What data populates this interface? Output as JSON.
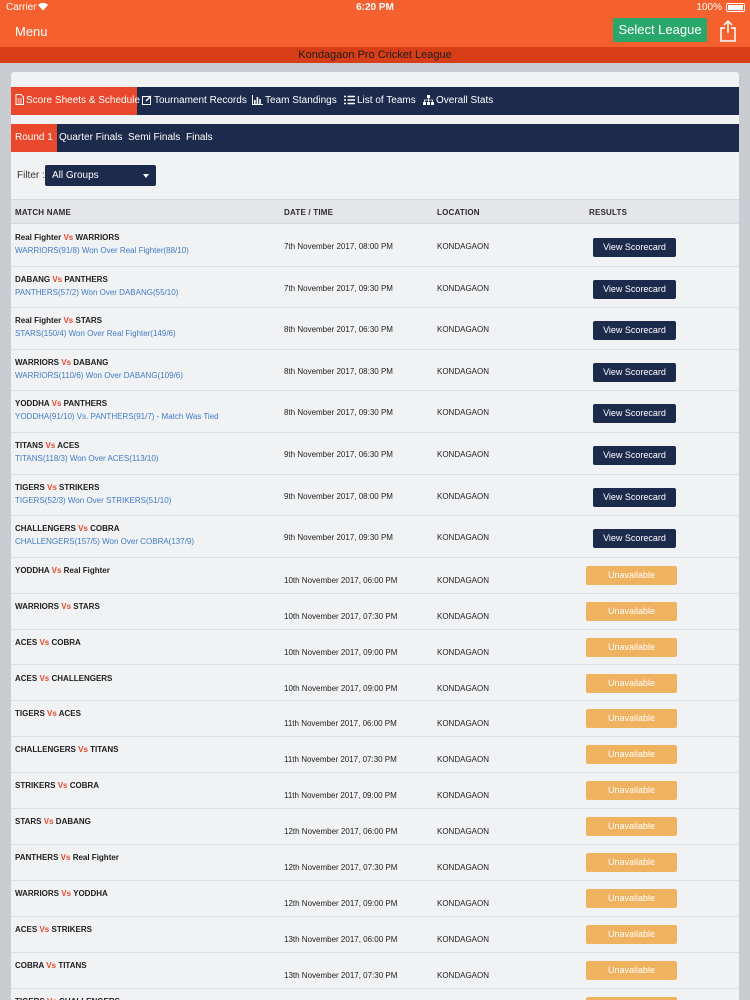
{
  "status_bar": {
    "carrier": "Carrier",
    "time": "6:20 PM",
    "battery": "100%"
  },
  "navbar": {
    "menu_label": "Menu",
    "select_league_label": "Select League"
  },
  "league_title": "Kondagaon Pro Cricket League",
  "tabs": [
    {
      "label": "Score Sheets & Schedule",
      "icon": "document-icon"
    },
    {
      "label": "Tournament Records",
      "icon": "edit-icon"
    },
    {
      "label": "Team Standings",
      "icon": "bar-chart-icon"
    },
    {
      "label": "List of Teams",
      "icon": "list-icon"
    },
    {
      "label": "Overall Stats",
      "icon": "sitemap-icon"
    }
  ],
  "subtabs": [
    "Round 1",
    "Quarter Finals",
    "Semi Finals",
    "Finals"
  ],
  "filter": {
    "label": "Filter :",
    "value": "All Groups"
  },
  "columns": [
    "MATCH NAME",
    "DATE / TIME",
    "LOCATION",
    "RESULTS"
  ],
  "vs_label": "Vs",
  "view_label": "View Scorecard",
  "unavailable_label": "Unavailable",
  "colors": {
    "primary_orange": "#f5612e",
    "navy": "#1c2a4c",
    "active_red": "#e9482c",
    "green": "#2aa76a",
    "unavailable": "#efb25f",
    "result_blue": "#3f7bc4"
  },
  "matches": [
    {
      "team1": "Real Fighter",
      "team2": "WARRIORS",
      "result": "WARRIORS(91/8) Won Over Real Fighter(88/10)",
      "date": "7th November 2017, 08:00 PM",
      "location": "KONDAGAON",
      "status": "view"
    },
    {
      "team1": "DABANG",
      "team2": "PANTHERS",
      "result": "PANTHERS(57/2) Won Over DABANG(55/10)",
      "date": "7th November 2017, 09:30 PM",
      "location": "KONDAGAON",
      "status": "view"
    },
    {
      "team1": "Real Fighter",
      "team2": "STARS",
      "result": "STARS(150/4) Won Over Real Fighter(149/6)",
      "date": "8th November 2017, 06:30 PM",
      "location": "KONDAGAON",
      "status": "view"
    },
    {
      "team1": "WARRIORS",
      "team2": "DABANG",
      "result": "WARRIORS(110/6) Won Over DABANG(109/6)",
      "date": "8th November 2017, 08:30 PM",
      "location": "KONDAGAON",
      "status": "view"
    },
    {
      "team1": "YODDHA",
      "team2": "PANTHERS",
      "result": "YODDHA(91/10) Vs. PANTHERS(91/7) - Match Was Tied",
      "date": "8th November 2017, 09:30 PM",
      "location": "KONDAGAON",
      "status": "view"
    },
    {
      "team1": "TITANS",
      "team2": "ACES",
      "result": "TITANS(118/3) Won Over ACES(113/10)",
      "date": "9th November 2017, 06:30 PM",
      "location": "KONDAGAON",
      "status": "view"
    },
    {
      "team1": "TIGERS",
      "team2": "STRIKERS",
      "result": "TIGERS(52/3) Won Over STRIKERS(51/10)",
      "date": "9th November 2017, 08:00 PM",
      "location": "KONDAGAON",
      "status": "view"
    },
    {
      "team1": "CHALLENGERS",
      "team2": "COBRA",
      "result": "CHALLENGERS(157/5) Won Over COBRA(137/9)",
      "date": "9th November 2017, 09:30 PM",
      "location": "KONDAGAON",
      "status": "view"
    },
    {
      "team1": "YODDHA",
      "team2": "Real Fighter",
      "result": "",
      "date": "10th November 2017, 06:00 PM",
      "location": "KONDAGAON",
      "status": "unavailable"
    },
    {
      "team1": "WARRIORS",
      "team2": "STARS",
      "result": "",
      "date": "10th November 2017, 07:30 PM",
      "location": "KONDAGAON",
      "status": "unavailable"
    },
    {
      "team1": "ACES",
      "team2": "COBRA",
      "result": "",
      "date": "10th November 2017, 09:00 PM",
      "location": "KONDAGAON",
      "status": "unavailable"
    },
    {
      "team1": "ACES",
      "team2": "CHALLENGERS",
      "result": "",
      "date": "10th November 2017, 09:00 PM",
      "location": "KONDAGAON",
      "status": "unavailable"
    },
    {
      "team1": "TIGERS",
      "team2": "ACES",
      "result": "",
      "date": "11th November 2017, 06:00 PM",
      "location": "KONDAGAON",
      "status": "unavailable"
    },
    {
      "team1": "CHALLENGERS",
      "team2": "TITANS",
      "result": "",
      "date": "11th November 2017, 07:30 PM",
      "location": "KONDAGAON",
      "status": "unavailable"
    },
    {
      "team1": "STRIKERS",
      "team2": "COBRA",
      "result": "",
      "date": "11th November 2017, 09:00 PM",
      "location": "KONDAGAON",
      "status": "unavailable"
    },
    {
      "team1": "STARS",
      "team2": "DABANG",
      "result": "",
      "date": "12th November 2017, 06:00 PM",
      "location": "KONDAGAON",
      "status": "unavailable"
    },
    {
      "team1": "PANTHERS",
      "team2": "Real Fighter",
      "result": "",
      "date": "12th November 2017, 07:30 PM",
      "location": "KONDAGAON",
      "status": "unavailable"
    },
    {
      "team1": "WARRIORS",
      "team2": "YODDHA",
      "result": "",
      "date": "12th November 2017, 09:00 PM",
      "location": "KONDAGAON",
      "status": "unavailable"
    },
    {
      "team1": "ACES",
      "team2": "STRIKERS",
      "result": "",
      "date": "13th November 2017, 06:00 PM",
      "location": "KONDAGAON",
      "status": "unavailable"
    },
    {
      "team1": "COBRA",
      "team2": "TITANS",
      "result": "",
      "date": "13th November 2017, 07:30 PM",
      "location": "KONDAGAON",
      "status": "unavailable"
    },
    {
      "team1": "TIGERS",
      "team2": "CHALLENGERS",
      "result": "",
      "date": "",
      "location": "",
      "status": "unavailable"
    }
  ]
}
